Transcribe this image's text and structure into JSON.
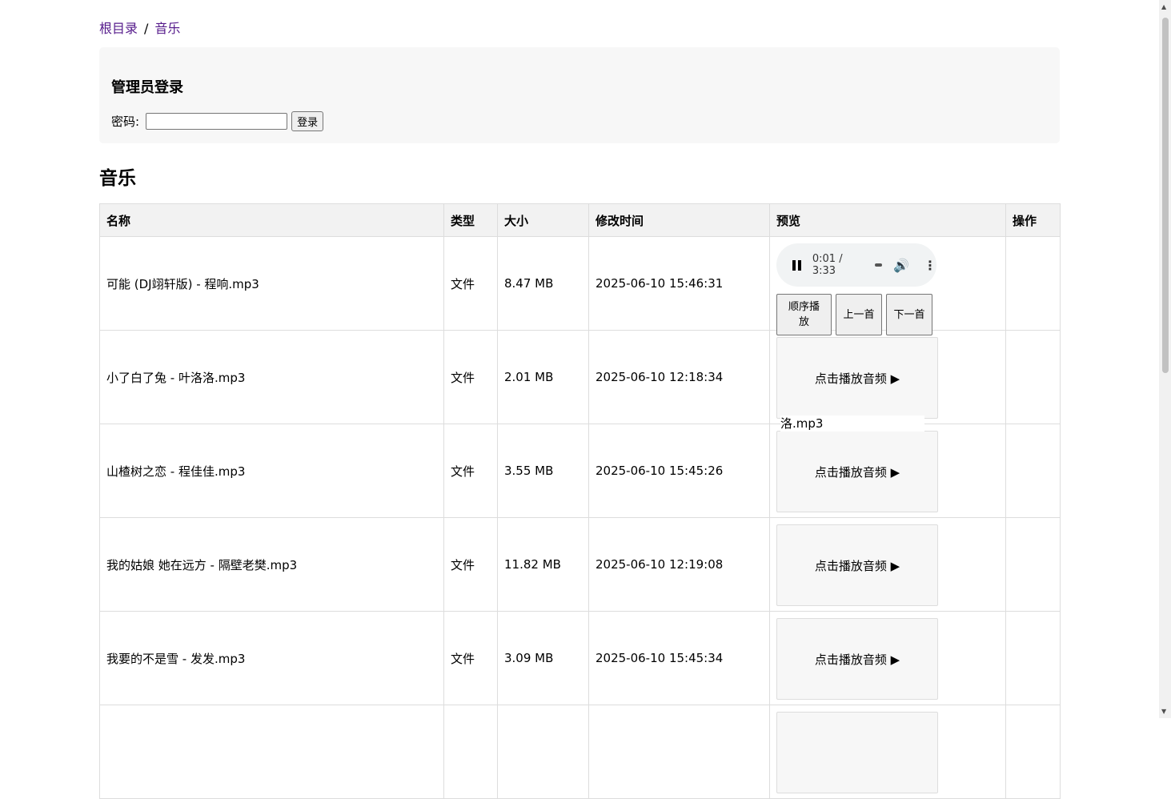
{
  "breadcrumb": {
    "root": "根目录",
    "separator": "/",
    "current": "音乐"
  },
  "login": {
    "title": "管理员登录",
    "password_label": "密码:",
    "password_value": "",
    "submit": "登录"
  },
  "section_title": "音乐",
  "table": {
    "headers": [
      "名称",
      "类型",
      "大小",
      "修改时间",
      "预览",
      "操作"
    ],
    "rows": [
      {
        "name": "可能 (DJ翊轩版) - 程响.mp3",
        "type": "文件",
        "size": "8.47 MB",
        "mtime": "2025-06-10 15:46:31"
      },
      {
        "name": "小了白了兔 - 叶洛洛.mp3",
        "type": "文件",
        "size": "2.01 MB",
        "mtime": "2025-06-10 12:18:34"
      },
      {
        "name": "山楂树之恋 - 程佳佳.mp3",
        "type": "文件",
        "size": "3.55 MB",
        "mtime": "2025-06-10 15:45:26"
      },
      {
        "name": "我的姑娘 她在远方 - 隔壁老樊.mp3",
        "type": "文件",
        "size": "11.82 MB",
        "mtime": "2025-06-10 12:19:08"
      },
      {
        "name": "我要的不是雪 - 发发.mp3",
        "type": "文件",
        "size": "3.09 MB",
        "mtime": "2025-06-10 15:45:34"
      }
    ]
  },
  "player": {
    "time_current": "0:01",
    "time_separator": "/",
    "time_total": "3:33",
    "buttons": {
      "sequential": "顺序播放",
      "previous": "上一首",
      "next": "下一首"
    }
  },
  "play_prompt": "点击播放音频 ▶",
  "overflow_text": "洛.mp3",
  "icons": {
    "pause": "pause-icon",
    "volume": "volume-icon",
    "more": "more-vertical-icon"
  }
}
